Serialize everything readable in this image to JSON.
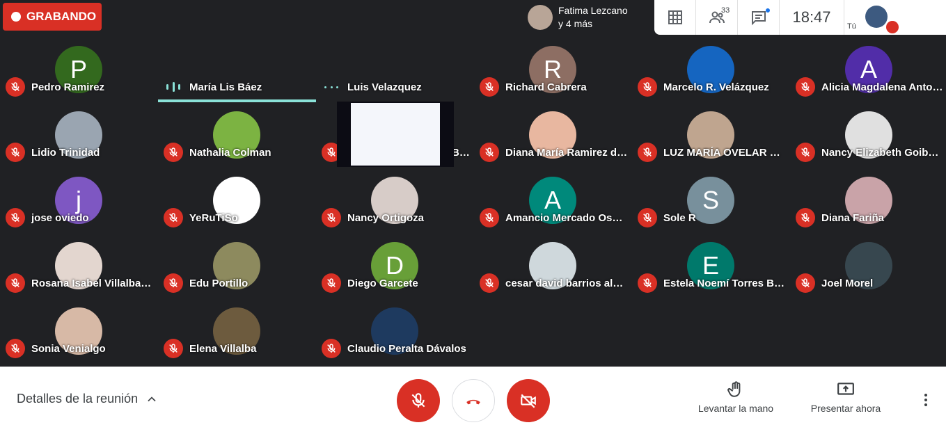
{
  "recording": {
    "label": "GRABANDO"
  },
  "presenter_chip": {
    "line1": "Fatima Lezcano",
    "line2": "y 4 más"
  },
  "header": {
    "participants_count": "33",
    "clock": "18:47",
    "self_label": "Tú"
  },
  "participants": [
    {
      "name": "Pedro Ramirez",
      "initial": "P",
      "color": "#33691e"
    },
    {
      "name": "María Lis Báez",
      "initial": "",
      "color": "#5aa7d6",
      "speaking": true
    },
    {
      "name": "Luis Velazquez",
      "initial": "",
      "color": "#c7ced6"
    },
    {
      "name": "Richard Cabrera",
      "initial": "R",
      "color": "#8d6e63"
    },
    {
      "name": "Marcelo R. Velázquez",
      "initial": "",
      "color": "#1565c0"
    },
    {
      "name": "Alicia Magdalena Antonia",
      "initial": "A",
      "color": "#512da8"
    },
    {
      "name": "Lidio Trinidad",
      "initial": "",
      "color": "#9aa5b1"
    },
    {
      "name": "Nathalia Colman",
      "initial": "",
      "color": "#7cb342"
    },
    {
      "name": "Presentación (Karen Benilda Giménez)",
      "initial": "",
      "color": "#0c0c14"
    },
    {
      "name": "Diana María Ramirez de Sosa",
      "initial": "",
      "color": "#e8b7a0"
    },
    {
      "name": "LUZ MARÍA OVELAR PEREIRA",
      "initial": "",
      "color": "#bfa58f"
    },
    {
      "name": "Nancy Elizabeth Goiburú",
      "initial": "",
      "color": "#e0e0e0"
    },
    {
      "name": "jose oviedo",
      "initial": "j",
      "color": "#7e57c2"
    },
    {
      "name": "YeRuTiSo",
      "initial": "",
      "color": "#ffffff"
    },
    {
      "name": "Nancy Ortigoza",
      "initial": "",
      "color": "#d7ccc8"
    },
    {
      "name": "Amancio Mercado Osorio",
      "initial": "A",
      "color": "#00897b"
    },
    {
      "name": "Sole R",
      "initial": "S",
      "color": "#78909c"
    },
    {
      "name": "Diana Fariña",
      "initial": "",
      "color": "#c9a3a8"
    },
    {
      "name": "Rosana Isabel Villalba Ruiz",
      "initial": "",
      "color": "#e3d6cf"
    },
    {
      "name": "Edu Portillo",
      "initial": "",
      "color": "#8d8a5e"
    },
    {
      "name": "Diego Garcete",
      "initial": "D",
      "color": "#689f38"
    },
    {
      "name": "cesar david barrios almada",
      "initial": "",
      "color": "#cfd8dc"
    },
    {
      "name": "Estela Noemí Torres Báez",
      "initial": "E",
      "color": "#00796b"
    },
    {
      "name": "Joel Morel",
      "initial": "",
      "color": "#37474f"
    },
    {
      "name": "Sonia Venialgo",
      "initial": "",
      "color": "#d7b9a6"
    },
    {
      "name": "Elena Villalba",
      "initial": "",
      "color": "#6d5b3e"
    },
    {
      "name": "Claudio Peralta Dávalos",
      "initial": "",
      "color": "#1e3a5f"
    }
  ],
  "bottom": {
    "details_label": "Detalles de la reunión",
    "raise_hand_label": "Levantar la mano",
    "present_label": "Presentar ahora"
  }
}
